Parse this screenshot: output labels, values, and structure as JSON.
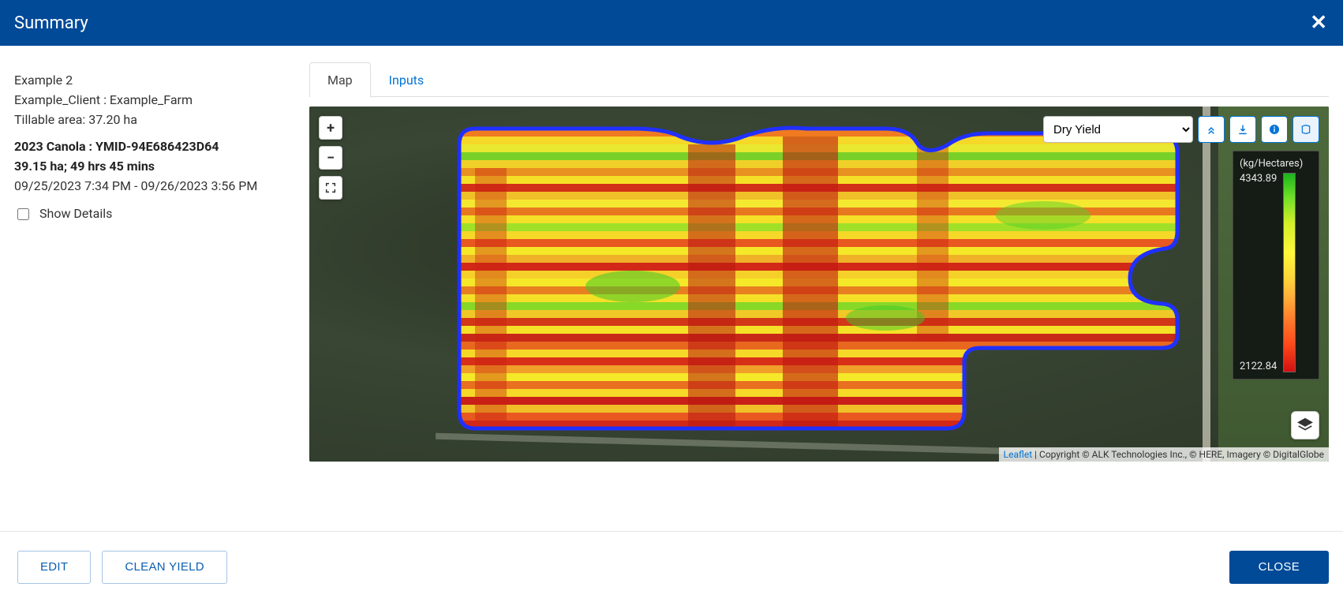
{
  "header": {
    "title": "Summary",
    "close_icon": "close"
  },
  "details": {
    "field_name": "Example 2",
    "client_farm": "Example_Client : Example_Farm",
    "tillable_label": "Tillable area: 37.20 ha",
    "crop_line": "2023 Canola : YMID-94E686423D64",
    "area_time": "39.15 ha; 49 hrs 45 mins",
    "date_range": "09/25/2023 7:34 PM - 09/26/2023 3:56 PM",
    "show_details_label": "Show Details"
  },
  "tabs": {
    "map": "Map",
    "inputs": "Inputs"
  },
  "map": {
    "layer_select_value": "Dry Yield",
    "zoom_in": "+",
    "zoom_out": "−",
    "legend": {
      "unit": "(kg/Hectares)",
      "max": "4343.89",
      "min": "2122.84"
    },
    "attribution_link": "Leaflet",
    "attribution_rest": " | Copyright © ALK Technologies Inc., © HERE, Imagery © DigitalGlobe"
  },
  "footer": {
    "edit": "EDIT",
    "clean_yield": "CLEAN YIELD",
    "close": "CLOSE"
  }
}
